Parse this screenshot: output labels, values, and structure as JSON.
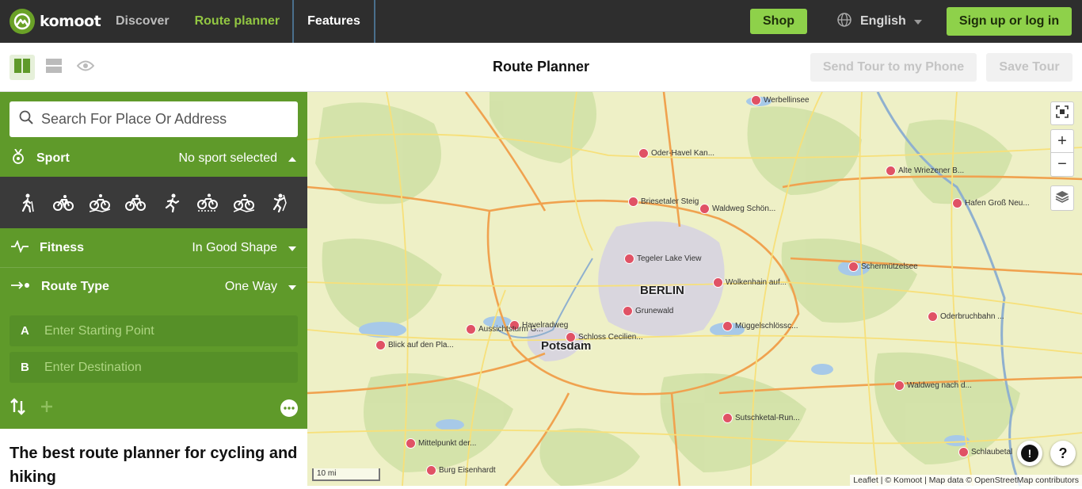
{
  "header": {
    "logo_text": "komoot",
    "nav": [
      "Discover",
      "Route planner",
      "Features"
    ],
    "shop": "Shop",
    "language": "English",
    "signup": "Sign up or log in"
  },
  "subbar": {
    "title": "Route Planner",
    "send_tour": "Send Tour to my Phone",
    "save_tour": "Save Tour"
  },
  "planner": {
    "search_placeholder": "Search For Place Or Address",
    "sport_label": "Sport",
    "sport_value": "No sport selected",
    "sports": [
      "hiking-icon",
      "road-cycling-icon",
      "mountain-biking-icon",
      "bike-touring-icon",
      "running-icon",
      "gravel-icon",
      "e-mtb-icon",
      "mountaineering-icon"
    ],
    "fitness_label": "Fitness",
    "fitness_value": "In Good Shape",
    "route_type_label": "Route Type",
    "route_type_value": "One Way",
    "start_letter": "A",
    "start_placeholder": "Enter Starting Point",
    "dest_letter": "B",
    "dest_placeholder": "Enter Destination",
    "promo_heading": "The best route planner for cycling and hiking"
  },
  "map": {
    "cities": [
      "BERLIN",
      "Potsdam"
    ],
    "pois": [
      "Werbellinsee",
      "Oder-Havel Kan...",
      "Alte Wriezener B...",
      "Briesetaler Steig",
      "Waldweg Schön...",
      "Hafen Groß Neu...",
      "Tegeler Lake View",
      "Schermützelsee",
      "Wolkenhain auf...",
      "Grunewald",
      "Havelradweg",
      "Aussichtsturm G...",
      "Schloss Cecilien...",
      "Müggelschlössc...",
      "Oderbruchbahn ...",
      "Blick auf den Pla...",
      "Waldweg nach d...",
      "Sutschketal-Run...",
      "Mittelpunkt der...",
      "Schlaubetal",
      "Burg Eisenhardt"
    ],
    "scale": "10 mi",
    "attribution": "Leaflet | © Komoot | Map data © OpenStreetMap contributors",
    "zoom_in": "+",
    "zoom_out": "−",
    "report": "!",
    "help": "?"
  },
  "colors": {
    "topbar": "#2e2e2e",
    "accent": "#8ed14a",
    "panel": "#5f9a2a",
    "poi": "#e05265"
  }
}
